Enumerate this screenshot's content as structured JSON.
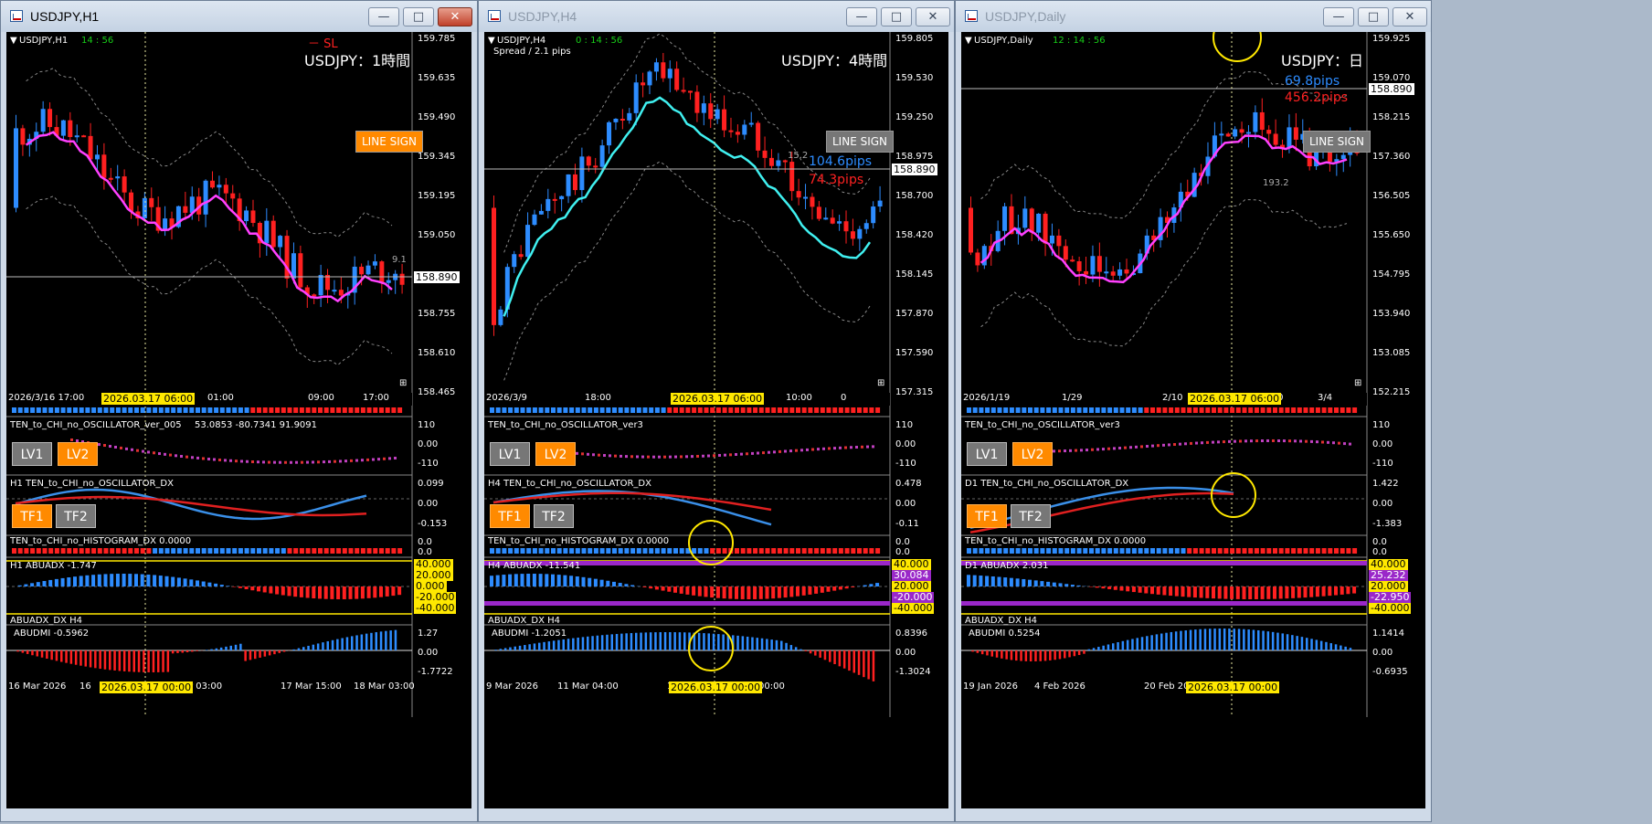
{
  "windows": [
    {
      "title": "USDJPY,H1",
      "active": true,
      "chart_name": "USDJPY,H1",
      "timer": "14 : 56",
      "spread": "",
      "big_title": "USDJPY：1時間",
      "sl_label": "－ SL",
      "pips_blue": "",
      "pips_red": "",
      "side_number": "9.1",
      "linesign": "LINE SIGN",
      "linesign_color": "#ff8a00",
      "price_labels": [
        "159.785",
        "159.635",
        "159.490",
        "159.345",
        "159.195",
        "159.050",
        "158.890",
        "158.755",
        "158.610",
        "158.465"
      ],
      "current_price": "158.890",
      "time_labels": [
        "2026/3/16 17:00",
        "17:00",
        "01:00",
        "09:00",
        "17:00"
      ],
      "date_tag": "2026.03.17 06:00",
      "osc_label": "TEN_to_CHI_no_OSCILLATOR_ver_005",
      "osc_values": "53.0853 -80.7341 91.9091",
      "osc_scale": [
        "110",
        "0.00",
        "-110"
      ],
      "lv1": "LV1",
      "lv2": "LV2",
      "dx_label": "H1 TEN_to_CHI_no_OSCILLATOR_DX",
      "dx_scale": [
        "0.099",
        "0.00",
        "-0.153"
      ],
      "tf1": "TF1",
      "tf2": "TF2",
      "hist_label": "TEN_to_CHI_no_HISTOGRAM_DX 0.0000",
      "hist_scale": [
        "0.0",
        "0.0"
      ],
      "abuadx_label": "H1 ABUADX -1.747",
      "abuadx_scale": [
        "40.000",
        "20.000",
        "0.000",
        "-20.000",
        "-40.000"
      ],
      "abuadx_h4": "ABUADX_DX H4",
      "abudmi_label": "ABUDMI -0.5962",
      "abudmi_scale": [
        "1.27",
        "0.00",
        "-1.7722"
      ],
      "bottom_time": [
        "16 Mar 2026",
        "16",
        "r 03:00",
        "17 Mar 15:00",
        "18 Mar 03:00"
      ],
      "bottom_tag": "2026.03.17 00:00"
    },
    {
      "title": "USDJPY,H4",
      "active": false,
      "chart_name": "USDJPY,H4",
      "timer": "0 : 14 : 56",
      "spread": "Spread / 2.1 pips",
      "big_title": "USDJPY：4時間",
      "sl_label": "",
      "pips_blue": "104.6pips",
      "pips_red": "74.3pips",
      "side_number": "15.2",
      "linesign": "LINE SIGN",
      "linesign_color": "#777777",
      "price_labels": [
        "159.805",
        "159.530",
        "159.250",
        "158.975",
        "158.700",
        "158.420",
        "158.145",
        "157.870",
        "157.590",
        "157.315"
      ],
      "current_price": "158.890",
      "time_labels": [
        "2026/3/9",
        "18:00",
        "02:00",
        "10:00",
        "0"
      ],
      "date_tag": "2026.03.17 06:00",
      "osc_label": "TEN_to_CHI_no_OSCILLATOR_ver3",
      "osc_values": "",
      "osc_scale": [
        "110",
        "0.00",
        "-110"
      ],
      "lv1": "LV1",
      "lv2": "LV2",
      "dx_label": "H4 TEN_to_CHI_no_OSCILLATOR_DX",
      "dx_scale": [
        "0.478",
        "0.00",
        "-0.11"
      ],
      "tf1": "TF1",
      "tf2": "TF2",
      "hist_label": "TEN_to_CHI_no_HISTOGRAM_DX 0.0000",
      "hist_scale": [
        "0.0",
        "0.0"
      ],
      "abuadx_label": "H4 ABUADX -11.541",
      "abuadx_scale": [
        "40.000",
        "30.084",
        "20.000",
        "-20.000",
        "-40.000"
      ],
      "abuadx_h4": "ABUADX_DX H4",
      "abudmi_label": "ABUDMI -1.2051",
      "abudmi_scale": [
        "0.8396",
        "0.00",
        "-1.3024"
      ],
      "bottom_time": [
        "9 Mar 2026",
        "11 Mar 04:00",
        "13 Mar",
        "00:00"
      ],
      "bottom_tag": "2026.03.17 00:00"
    },
    {
      "title": "USDJPY,Daily",
      "active": false,
      "chart_name": "USDJPY,Daily",
      "timer": "12 : 14 : 56",
      "spread": "",
      "big_title": "USDJPY：日",
      "sl_label": "",
      "pips_blue": "69.8pips",
      "pips_red": "456.2pips",
      "side_number": "193.2",
      "linesign": "LINE SIGN",
      "linesign_color": "#777777",
      "price_labels": [
        "159.925",
        "159.070",
        "158.215",
        "157.360",
        "156.505",
        "155.650",
        "154.795",
        "153.940",
        "153.085",
        "152.215"
      ],
      "current_price": "158.890",
      "time_labels": [
        "2026/1/19",
        "1/29",
        "2/10",
        "2/20",
        "3/4"
      ],
      "date_tag": "2026.03.17 06:00",
      "osc_label": "TEN_to_CHI_no_OSCILLATOR_ver3",
      "osc_values": "",
      "osc_scale": [
        "110",
        "0.00",
        "-110"
      ],
      "lv1": "LV1",
      "lv2": "LV2",
      "dx_label": "D1 TEN_to_CHI_no_OSCILLATOR_DX",
      "dx_scale": [
        "1.422",
        "0.00",
        "-1.383"
      ],
      "tf1": "TF1",
      "tf2": "TF2",
      "hist_label": "TEN_to_CHI_no_HISTOGRAM_DX 0.0000",
      "hist_scale": [
        "0.0",
        "0.0"
      ],
      "abuadx_label": "D1 ABUADX 2.031",
      "abuadx_scale": [
        "40.000",
        "25.232",
        "20.000",
        "-22.950",
        "-40.000"
      ],
      "abuadx_h4": "ABUADX_DX H4",
      "abudmi_label": "ABUDMI 0.5254",
      "abudmi_scale": [
        "1.1414",
        "0.00",
        "-0.6935"
      ],
      "bottom_time": [
        "19 Jan 2026",
        "4 Feb 2026",
        "20 Feb 2026"
      ],
      "bottom_tag": "2026.03.17 00:00"
    }
  ],
  "colors": {
    "bull": "#2d8cff",
    "bear": "#ff2020",
    "ma_magenta": "#ff40ff",
    "ma_cyan": "#40f0f0",
    "highlight": "#ffe800"
  }
}
